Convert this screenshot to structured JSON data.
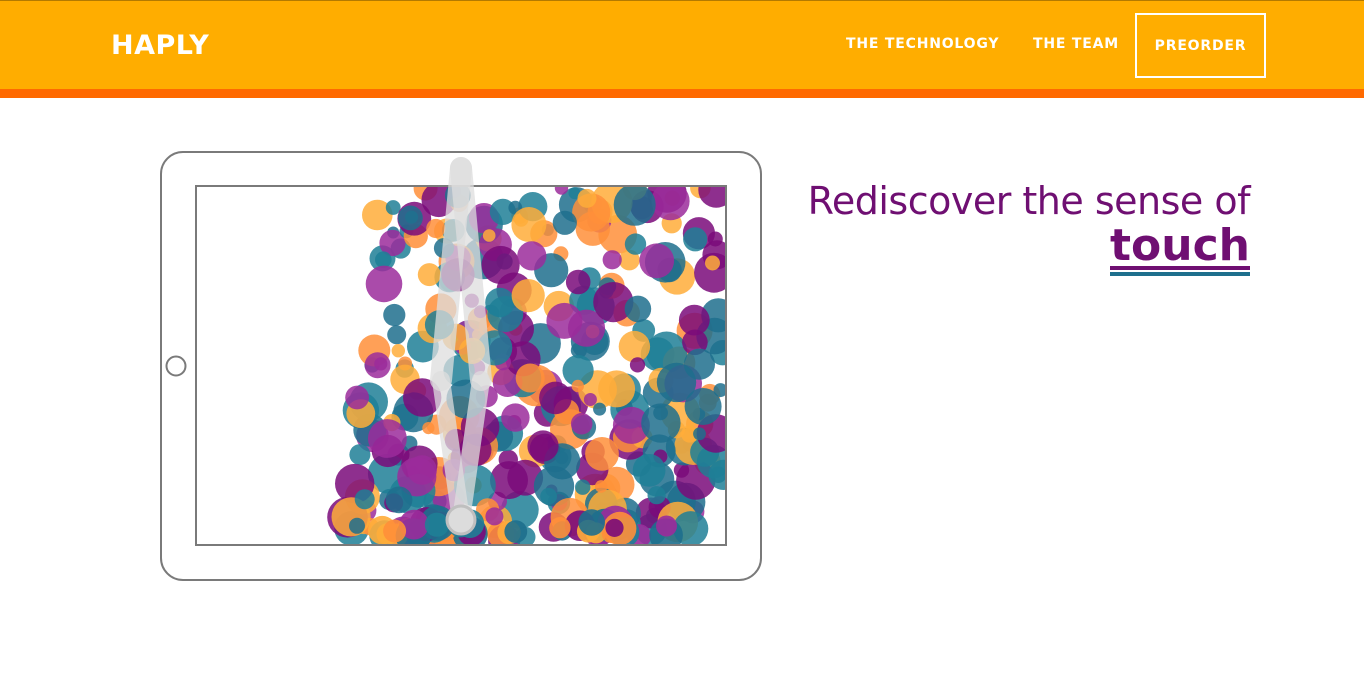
{
  "header": {
    "brand": "HAPLY",
    "nav": [
      {
        "label": "THE TECHNOLOGY"
      },
      {
        "label": "THE TEAM"
      }
    ],
    "cta_label": "PREORDER",
    "colors": {
      "bar": "#ffad00",
      "stripe": "#ff6a00"
    }
  },
  "hero": {
    "tagline_line1": "Rediscover the sense of",
    "tagline_emphasis": "touch",
    "colors": {
      "headline": "#6f0f72",
      "underline2": "#1e6f8d"
    }
  },
  "illustration": {
    "palette": [
      "#ff8f3a",
      "#ffad3a",
      "#9b2b9b",
      "#1f7f96",
      "#7a0a7a",
      "#1e6f8d"
    ],
    "device_outline": "#7a7a7a",
    "stylus_color": "#dddddd"
  }
}
